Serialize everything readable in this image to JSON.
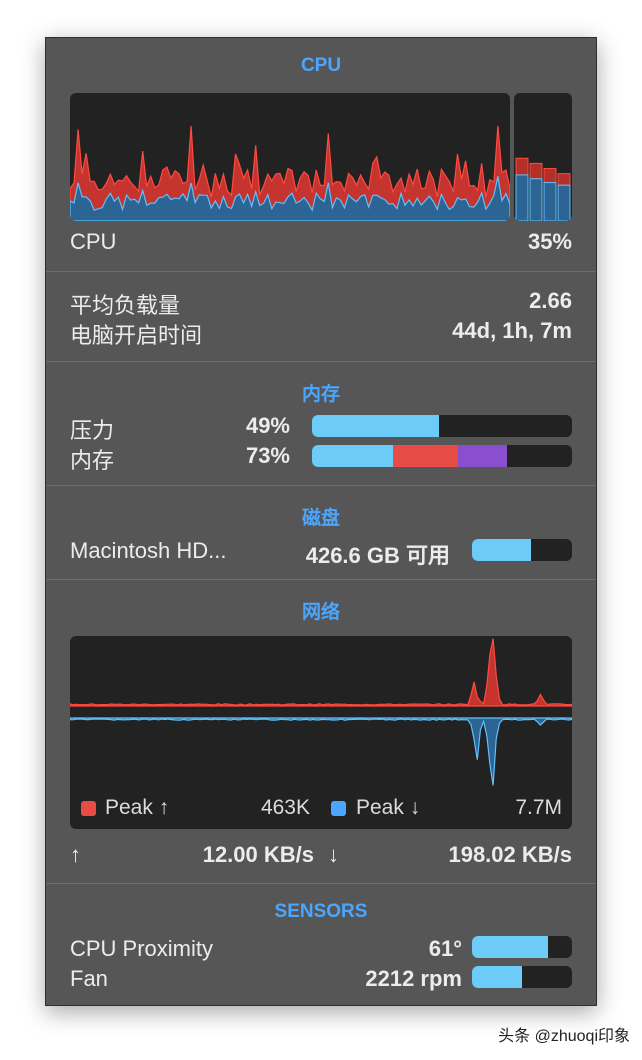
{
  "cpu": {
    "header": "CPU",
    "label": "CPU",
    "value": "35%",
    "core_levels": [
      {
        "user": 0.36,
        "system": 0.13
      },
      {
        "user": 0.33,
        "system": 0.12
      },
      {
        "user": 0.3,
        "system": 0.11
      },
      {
        "user": 0.28,
        "system": 0.09
      }
    ]
  },
  "system": {
    "load_label": "平均负载量",
    "load_value": "2.66",
    "uptime_label": "电脑开启时间",
    "uptime_value": "44d, 1h, 7m"
  },
  "memory": {
    "header": "内存",
    "pressure_label": "压力",
    "pressure_value": "49%",
    "pressure_fraction": 0.49,
    "usage_label": "内存",
    "usage_value": "73%",
    "usage_segments": [
      {
        "fraction": 0.31,
        "color": "#6ccbf7"
      },
      {
        "fraction": 0.25,
        "color": "#e84c47"
      },
      {
        "fraction": 0.19,
        "color": "#8a4fcf"
      }
    ]
  },
  "disk": {
    "header": "磁盘",
    "name": "Macintosh HD...",
    "value": "426.6 GB 可用",
    "fraction": 0.59
  },
  "network": {
    "header": "网络",
    "peak_up_label": "Peak ↑",
    "peak_up_value": "463K",
    "peak_down_label": "Peak ↓",
    "peak_down_value": "7.7M",
    "up_arrow": "↑",
    "up_rate": "12.00 KB/s",
    "down_arrow": "↓",
    "down_rate": "198.02 KB/s",
    "up_color": "#e84c47",
    "down_color": "#4aa6ff"
  },
  "sensors": {
    "header": "SENSORS",
    "items": [
      {
        "label": "CPU Proximity",
        "value": "61°",
        "fraction": 0.76
      },
      {
        "label": "Fan",
        "value": "2212 rpm",
        "fraction": 0.5
      }
    ]
  },
  "colors": {
    "accent": "#4aa6ff",
    "bar_fill": "#6ccbf7",
    "cpu_user": "#2e6ea2",
    "cpu_system": "#d13a34",
    "panel": "#565656"
  },
  "watermark": "头条 @zhuoqi印象"
}
